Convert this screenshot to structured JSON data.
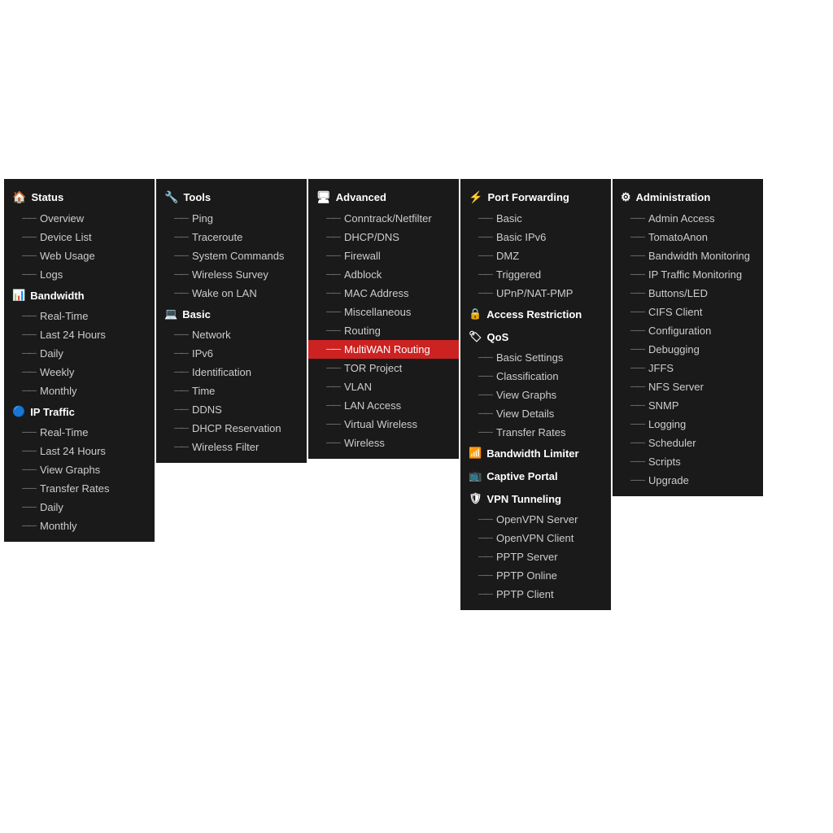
{
  "panels": [
    {
      "id": "status",
      "header": {
        "icon": "🏠",
        "label": "Status"
      },
      "items": [
        {
          "label": "Overview",
          "active": false
        },
        {
          "label": "Device List",
          "active": false
        },
        {
          "label": "Web Usage",
          "active": false
        },
        {
          "label": "Logs",
          "active": false
        }
      ],
      "sections": [
        {
          "header": {
            "icon": "📊",
            "label": "Bandwidth"
          },
          "items": [
            {
              "label": "Real-Time",
              "active": false
            },
            {
              "label": "Last 24 Hours",
              "active": false
            },
            {
              "label": "Daily",
              "active": false
            },
            {
              "label": "Weekly",
              "active": false
            },
            {
              "label": "Monthly",
              "active": false
            }
          ]
        },
        {
          "header": {
            "icon": "🔵",
            "label": "IP Traffic"
          },
          "items": [
            {
              "label": "Real-Time",
              "active": false
            },
            {
              "label": "Last 24 Hours",
              "active": false
            },
            {
              "label": "View Graphs",
              "active": false
            },
            {
              "label": "Transfer Rates",
              "active": false
            },
            {
              "label": "Daily",
              "active": false
            },
            {
              "label": "Monthly",
              "active": false
            }
          ]
        }
      ]
    },
    {
      "id": "tools",
      "header": {
        "icon": "🔧",
        "label": "Tools"
      },
      "items": [
        {
          "label": "Ping",
          "active": false
        },
        {
          "label": "Traceroute",
          "active": false
        },
        {
          "label": "System Commands",
          "active": false
        },
        {
          "label": "Wireless Survey",
          "active": false
        },
        {
          "label": "Wake on LAN",
          "active": false
        }
      ],
      "sections": [
        {
          "header": {
            "icon": "💻",
            "label": "Basic"
          },
          "items": [
            {
              "label": "Network",
              "active": false
            },
            {
              "label": "IPv6",
              "active": false
            },
            {
              "label": "Identification",
              "active": false
            },
            {
              "label": "Time",
              "active": false
            },
            {
              "label": "DDNS",
              "active": false
            },
            {
              "label": "DHCP Reservation",
              "active": false
            },
            {
              "label": "Wireless Filter",
              "active": false
            }
          ]
        }
      ]
    },
    {
      "id": "advanced",
      "header": {
        "icon": "🖥",
        "label": "Advanced"
      },
      "items": [
        {
          "label": "Conntrack/Netfilter",
          "active": false
        },
        {
          "label": "DHCP/DNS",
          "active": false
        },
        {
          "label": "Firewall",
          "active": false
        },
        {
          "label": "Adblock",
          "active": false
        },
        {
          "label": "MAC Address",
          "active": false
        },
        {
          "label": "Miscellaneous",
          "active": false
        },
        {
          "label": "Routing",
          "active": false
        },
        {
          "label": "MultiWAN Routing",
          "active": true
        },
        {
          "label": "TOR Project",
          "active": false
        },
        {
          "label": "VLAN",
          "active": false
        },
        {
          "label": "LAN Access",
          "active": false
        },
        {
          "label": "Virtual Wireless",
          "active": false
        },
        {
          "label": "Wireless",
          "active": false
        }
      ],
      "sections": []
    },
    {
      "id": "port-forwarding",
      "header": {
        "icon": "⚡",
        "label": "Port Forwarding"
      },
      "items": [
        {
          "label": "Basic",
          "active": false
        },
        {
          "label": "Basic IPv6",
          "active": false
        },
        {
          "label": "DMZ",
          "active": false
        },
        {
          "label": "Triggered",
          "active": false
        },
        {
          "label": "UPnP/NAT-PMP",
          "active": false
        }
      ],
      "sections": [
        {
          "header": {
            "icon": "🔒",
            "label": "Access Restriction"
          },
          "items": []
        },
        {
          "header": {
            "icon": "🏷",
            "label": "QoS"
          },
          "items": [
            {
              "label": "Basic Settings",
              "active": false
            },
            {
              "label": "Classification",
              "active": false
            },
            {
              "label": "View Graphs",
              "active": false
            },
            {
              "label": "View Details",
              "active": false
            },
            {
              "label": "Transfer Rates",
              "active": false
            }
          ]
        },
        {
          "header": {
            "icon": "📶",
            "label": "Bandwidth Limiter"
          },
          "items": []
        },
        {
          "header": {
            "icon": "📺",
            "label": "Captive Portal"
          },
          "items": []
        },
        {
          "header": {
            "icon": "🛡",
            "label": "VPN Tunneling"
          },
          "items": [
            {
              "label": "OpenVPN Server",
              "active": false
            },
            {
              "label": "OpenVPN Client",
              "active": false
            },
            {
              "label": "PPTP Server",
              "active": false
            },
            {
              "label": "PPTP Online",
              "active": false
            },
            {
              "label": "PPTP Client",
              "active": false
            }
          ]
        }
      ]
    },
    {
      "id": "administration",
      "header": {
        "icon": "⚙",
        "label": "Administration"
      },
      "items": [
        {
          "label": "Admin Access",
          "active": false
        },
        {
          "label": "TomatoAnon",
          "active": false
        },
        {
          "label": "Bandwidth Monitoring",
          "active": false
        },
        {
          "label": "IP Traffic Monitoring",
          "active": false
        },
        {
          "label": "Buttons/LED",
          "active": false
        },
        {
          "label": "CIFS Client",
          "active": false
        },
        {
          "label": "Configuration",
          "active": false
        },
        {
          "label": "Debugging",
          "active": false
        },
        {
          "label": "JFFS",
          "active": false
        },
        {
          "label": "NFS Server",
          "active": false
        },
        {
          "label": "SNMP",
          "active": false
        },
        {
          "label": "Logging",
          "active": false
        },
        {
          "label": "Scheduler",
          "active": false
        },
        {
          "label": "Scripts",
          "active": false
        },
        {
          "label": "Upgrade",
          "active": false
        }
      ],
      "sections": []
    }
  ]
}
